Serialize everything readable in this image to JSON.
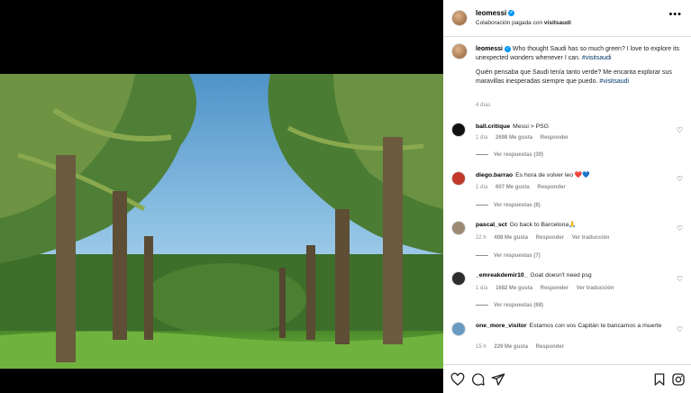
{
  "header": {
    "username": "leomessi",
    "collab_prefix": "Colaboración pagada con",
    "collab_partner": "visitsaudi",
    "more_label": "•••"
  },
  "caption": {
    "username": "leomessi",
    "text_en": "Who thought Saudi has so much green? I love to explore its unexpected wonders whenever I can.",
    "hashtag_1": "#visitsaudi",
    "text_es": "Quién pensaba que Saudi tenía tanto verde? Me encanta explorar sus maravillas inesperadas siempre que puedo.",
    "hashtag_2": "#visitsaudi",
    "time": "4 días"
  },
  "comments": [
    {
      "user": "ball.critique",
      "text": "Messi > PSG",
      "time": "1 día",
      "likes": "2698 Me gusta",
      "reply": "Responder",
      "translate": "",
      "replies": "Ver respuestas (30)",
      "avatar_color": "#111111"
    },
    {
      "user": "diego.barrao",
      "text": "Es hora de volver leo ❤️💙",
      "time": "1 día",
      "likes": "607 Me gusta",
      "reply": "Responder",
      "translate": "",
      "replies": "Ver respuestas (8)",
      "avatar_color": "#c0392b"
    },
    {
      "user": "pascal_sct",
      "text": "Go back to Barcelona🙏",
      "time": "22 h",
      "likes": "408 Me gusta",
      "reply": "Responder",
      "translate": "Ver traducción",
      "replies": "Ver respuestas (7)",
      "avatar_color": "#9c8a74"
    },
    {
      "user": "_emreakdemir10_",
      "text": "Goat doesn't need psg",
      "time": "1 día",
      "likes": "1682 Me gusta",
      "reply": "Responder",
      "translate": "Ver traducción",
      "replies": "Ver respuestas (68)",
      "avatar_color": "#2d2d2d"
    },
    {
      "user": "one_more_visitor",
      "text": "Estamos con vos Capitán te bancamos a muerte",
      "time": "15 h",
      "likes": "229 Me gusta",
      "reply": "Responder",
      "translate": "",
      "replies": "",
      "avatar_color": "#6a9bc3"
    }
  ],
  "icons": {
    "like": "heart-icon",
    "comment": "comment-icon",
    "share": "share-icon",
    "save": "bookmark-icon",
    "more": "more-icon"
  },
  "colors": {
    "verified": "#0095f6",
    "hashtag": "#00376b",
    "meta": "#8e8e8e"
  }
}
